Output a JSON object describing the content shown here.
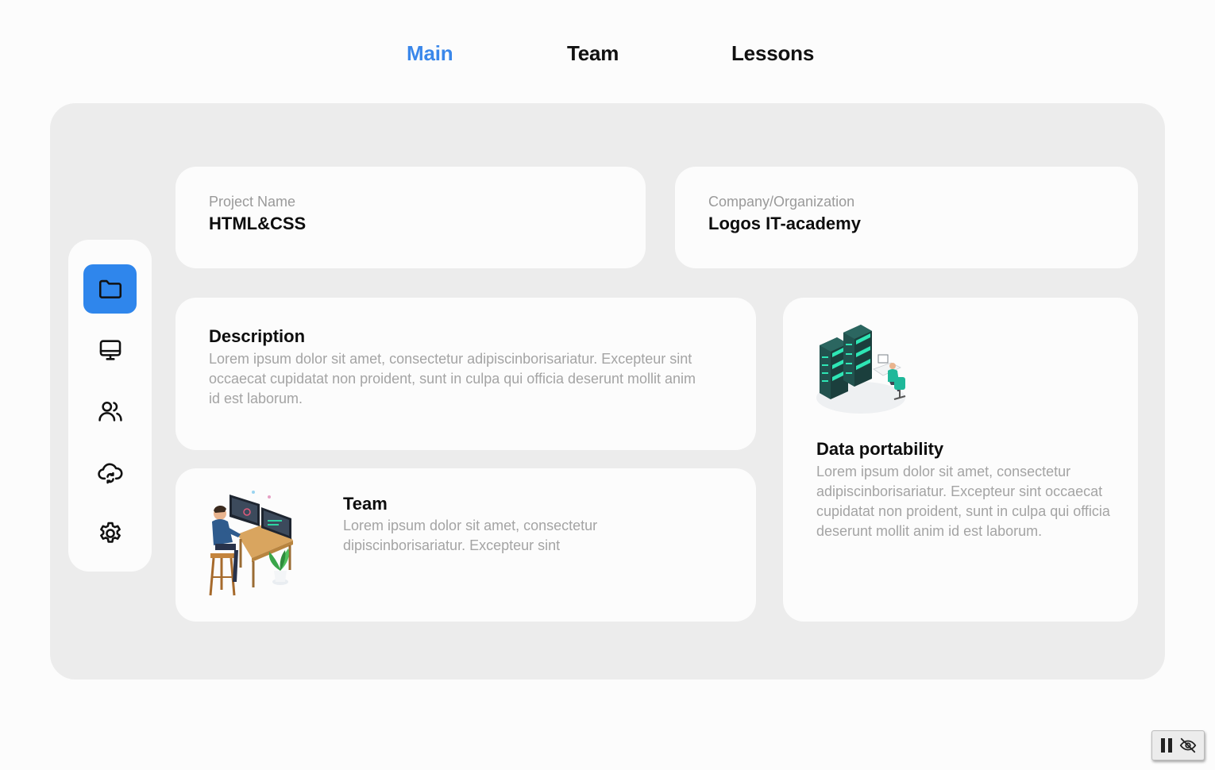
{
  "nav": {
    "main": "Main",
    "team": "Team",
    "lessons": "Lessons"
  },
  "colors": {
    "accent": "#2f86ec",
    "nav_active": "#3a87ea",
    "panel_bg": "#ececec",
    "card_bg": "#fcfcfc",
    "muted_text": "#a4a4a4",
    "illustration_teal": "#1fb89a"
  },
  "sidebar": {
    "items": [
      {
        "icon": "folder-icon",
        "active": true
      },
      {
        "icon": "monitor-icon",
        "active": false
      },
      {
        "icon": "users-icon",
        "active": false
      },
      {
        "icon": "cloud-sync-icon",
        "active": false
      },
      {
        "icon": "gear-icon",
        "active": false
      }
    ]
  },
  "project": {
    "label": "Project Name",
    "value": "HTML&CSS"
  },
  "company": {
    "label": "Company/Organization",
    "value": "Logos IT-academy"
  },
  "description": {
    "title": "Description",
    "text": "Lorem ipsum dolor sit amet, consectetur adipiscinborisariatur. Excepteur sint occaecat cupidatat non proident, sunt in culpa qui officia deserunt mollit anim id est laborum."
  },
  "team_card": {
    "title": "Team",
    "text": "Lorem ipsum dolor sit amet, consectetur dipiscinborisariatur. Excepteur sint"
  },
  "data_card": {
    "title": "Data portability",
    "text": "Lorem ipsum dolor sit amet, consectetur adipiscinborisariatur. Excepteur sint occaecat cupidatat non proident, sunt in culpa qui officia deserunt mollit anim id est laborum."
  },
  "player_controls": {
    "pause_icon": "pause-icon",
    "hide_icon": "eye-off-icon"
  }
}
